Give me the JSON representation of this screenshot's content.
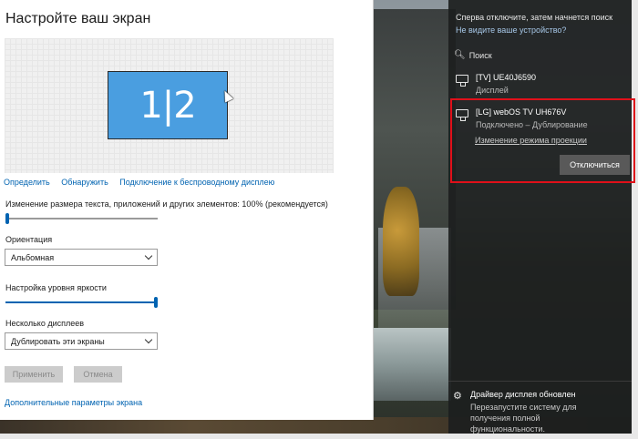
{
  "settings": {
    "title": "Настройте ваш экран",
    "monitor_label": "1|2",
    "links": {
      "identify": "Определить",
      "detect": "Обнаружить",
      "wireless": "Подключение к беспроводному дисплею"
    },
    "scale_label": "Изменение размера текста, приложений и других элементов: 100% (рекомендуется)",
    "scale_slider_value": 0,
    "orientation_label": "Ориентация",
    "orientation_value": "Альбомная",
    "brightness_label": "Настройка уровня яркости",
    "brightness_value": 100,
    "multi_display_label": "Несколько дисплеев",
    "multi_display_value": "Дублировать эти экраны",
    "apply_button": "Применить",
    "cancel_button": "Отмена",
    "advanced_link": "Дополнительные параметры экрана"
  },
  "panel": {
    "header_text": "Сперва отключите, затем начнется поиск",
    "header_link": "Не видите ваше устройство?",
    "search_label": "Поиск",
    "devices": [
      {
        "name": "[TV] UE40J6590",
        "sub": "Дисплей"
      },
      {
        "name": "[LG] webOS TV UH676V",
        "sub": "Подключено – Дублирование"
      }
    ],
    "change_mode_link": "Изменение режима проекции",
    "disconnect_button": "Отключиться"
  },
  "notification": {
    "title": "Драйвер дисплея обновлен",
    "body": "Перезапустите систему для получения полной функциональности."
  },
  "colors": {
    "accent": "#0063b1",
    "monitor_fill": "#4a9ee0",
    "highlight": "#e0101a"
  }
}
